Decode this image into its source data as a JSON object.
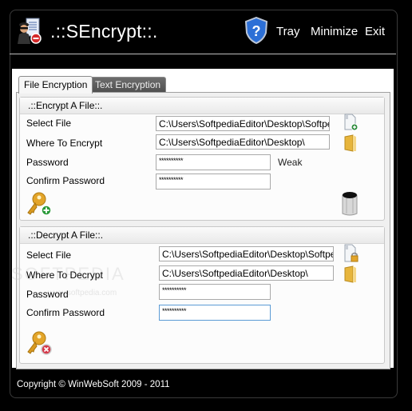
{
  "header": {
    "title": ".::SEncrypt::.",
    "links": {
      "tray": "Tray",
      "minimize": "Minimize",
      "exit": "Exit"
    },
    "icons": {
      "app": "spy-document-icon",
      "help": "help-shield-icon"
    }
  },
  "tabs": [
    {
      "label": "File Encryption",
      "active": true
    },
    {
      "label": "Text Encryption",
      "active": false
    }
  ],
  "encrypt": {
    "title": ".::Encrypt A File::.",
    "select_file_label": "Select File",
    "select_file_value": "C:\\Users\\SoftpediaEditor\\Desktop\\Softpedia",
    "where_label": "Where To Encrypt",
    "where_value": "C:\\Users\\SoftpediaEditor\\Desktop\\",
    "password_label": "Password",
    "password_value": "**********",
    "strength": "Weak",
    "confirm_label": "Confirm Password",
    "confirm_value": "**********"
  },
  "decrypt": {
    "title": ".::Decrypt A File::.",
    "select_file_label": "Select File",
    "select_file_value": "C:\\Users\\SoftpediaEditor\\Desktop\\Softpedia",
    "where_label": "Where To Decrypt",
    "where_value": "C:\\Users\\SoftpediaEditor\\Desktop\\",
    "password_label": "Password",
    "password_value": "**********",
    "confirm_label": "Confirm Password",
    "confirm_value": "**********"
  },
  "watermark": {
    "big": "SOFTPEDIA",
    "small": "www.softpedia.com"
  },
  "footer": {
    "copyright": "Copyright © WinWebSoft 2009 - 2011"
  }
}
